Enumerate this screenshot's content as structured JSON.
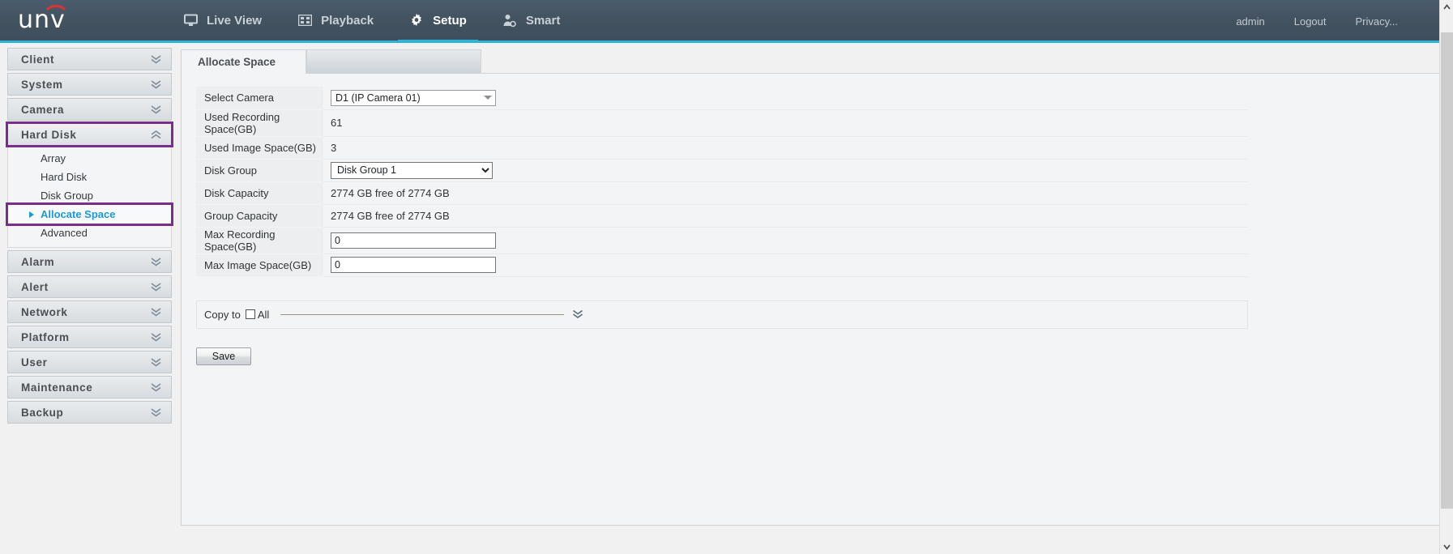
{
  "header": {
    "logo_text": "unv",
    "nav": [
      {
        "label": "Live View",
        "icon": "monitor-icon",
        "active": false
      },
      {
        "label": "Playback",
        "icon": "film-icon",
        "active": false
      },
      {
        "label": "Setup",
        "icon": "gear-icon",
        "active": true
      },
      {
        "label": "Smart",
        "icon": "person-search-icon",
        "active": false
      }
    ],
    "user": "admin",
    "logout": "Logout",
    "privacy": "Privacy..."
  },
  "sidebar": {
    "groups": [
      {
        "label": "Client",
        "expanded": false,
        "highlight": false
      },
      {
        "label": "System",
        "expanded": false,
        "highlight": false
      },
      {
        "label": "Camera",
        "expanded": false,
        "highlight": false
      },
      {
        "label": "Hard Disk",
        "expanded": true,
        "highlight": true,
        "items": [
          {
            "label": "Array",
            "selected": false
          },
          {
            "label": "Hard Disk",
            "selected": false
          },
          {
            "label": "Disk Group",
            "selected": false
          },
          {
            "label": "Allocate Space",
            "selected": true
          },
          {
            "label": "Advanced",
            "selected": false
          }
        ]
      },
      {
        "label": "Alarm",
        "expanded": false,
        "highlight": false
      },
      {
        "label": "Alert",
        "expanded": false,
        "highlight": false
      },
      {
        "label": "Network",
        "expanded": false,
        "highlight": false
      },
      {
        "label": "Platform",
        "expanded": false,
        "highlight": false
      },
      {
        "label": "User",
        "expanded": false,
        "highlight": false
      },
      {
        "label": "Maintenance",
        "expanded": false,
        "highlight": false
      },
      {
        "label": "Backup",
        "expanded": false,
        "highlight": false
      }
    ]
  },
  "main": {
    "tab_label": "Allocate Space",
    "rows": {
      "select_camera": {
        "label": "Select Camera",
        "value": "D1 (IP Camera 01)"
      },
      "used_recording_space": {
        "label": "Used Recording Space(GB)",
        "value": "61"
      },
      "used_image_space": {
        "label": "Used Image Space(GB)",
        "value": "3"
      },
      "disk_group": {
        "label": "Disk Group",
        "value": "Disk Group 1"
      },
      "disk_capacity": {
        "label": "Disk Capacity",
        "value": "2774 GB free of 2774 GB"
      },
      "group_capacity": {
        "label": "Group Capacity",
        "value": "2774 GB free of 2774 GB"
      },
      "max_recording_space": {
        "label": "Max Recording Space(GB)",
        "value": "0"
      },
      "max_image_space": {
        "label": "Max Image Space(GB)",
        "value": "0"
      }
    },
    "copy_to": {
      "label": "Copy to",
      "all_label": "All",
      "checked": false
    },
    "save_label": "Save"
  },
  "colors": {
    "accent": "#2bb3d8",
    "header_bg": "#42525f",
    "highlight_outline": "#7b2d8e",
    "selected_text": "#1b9ad6",
    "logo_arc": "#e03131"
  }
}
